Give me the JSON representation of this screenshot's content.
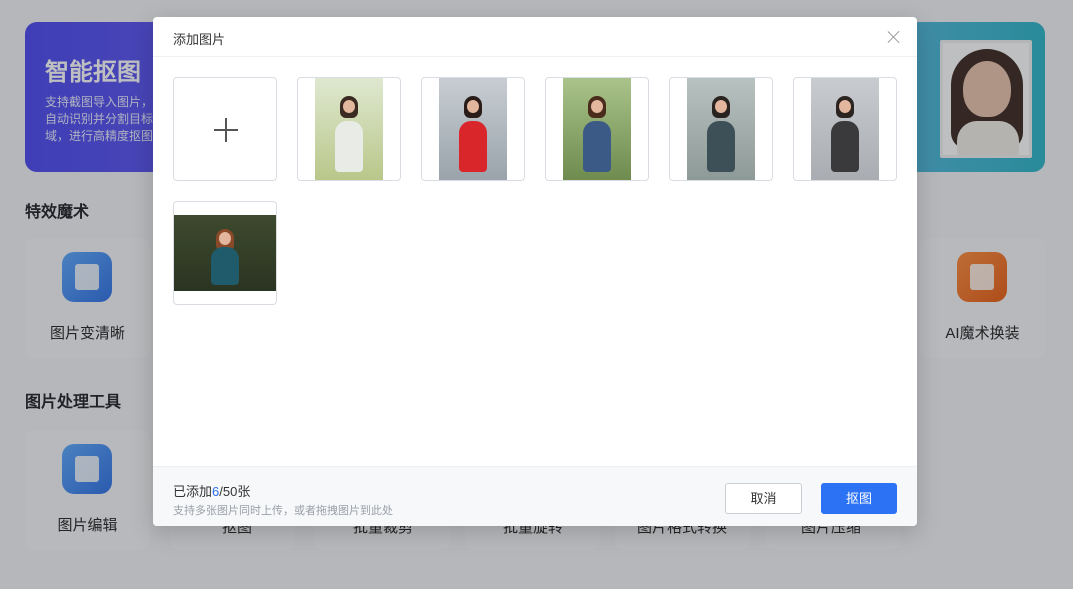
{
  "background": {
    "banner": {
      "title": "智能抠图",
      "desc_line1": "支持截图导入图片，",
      "desc_line2": "自动识别并分割目标",
      "desc_line3": "域，进行高精度抠图"
    },
    "section_effects": "特效魔术",
    "section_tools": "图片处理工具",
    "tools": {
      "sharpen": "图片变清晰",
      "ai_outfit": "AI魔术换装",
      "edit": "图片编辑",
      "crop_partial": "抠图",
      "batch_crop_partial": "批量裁剪",
      "batch_rotate_partial": "批量旋转",
      "format_partial": "图片格式转换",
      "compress_partial": "图片压缩"
    }
  },
  "modal": {
    "title": "添加图片",
    "photos": [
      {
        "name": "photo-1",
        "colors": {
          "bg": "#b9c78a",
          "top": "#dfe8d0",
          "dress": "#e9ebe6",
          "hair": "#3b2a22"
        }
      },
      {
        "name": "photo-2",
        "colors": {
          "bg": "#9aa3ab",
          "top": "#c7cdd2",
          "dress": "#d8262a",
          "hair": "#2a1d19"
        }
      },
      {
        "name": "photo-3",
        "colors": {
          "bg": "#6f8b4e",
          "top": "#a9c38a",
          "dress": "#3b5a86",
          "hair": "#4a2c1c"
        }
      },
      {
        "name": "photo-4",
        "colors": {
          "bg": "#8e9a98",
          "top": "#b8c2c0",
          "dress": "#3d5058",
          "hair": "#2a2420"
        }
      },
      {
        "name": "photo-5",
        "colors": {
          "bg": "#a9adb2",
          "top": "#c8ccd0",
          "dress": "#3a3a3c",
          "hair": "#2b2420"
        }
      },
      {
        "name": "photo-6",
        "colors": {
          "bg": "#2a3422",
          "top": "#3e4a2e",
          "dress": "#1f5b6a",
          "hair": "#8a4a2a"
        }
      }
    ],
    "footer": {
      "count_prefix": "已添加",
      "count_current": "6",
      "count_suffix": "/50张",
      "hint": "支持多张图片同时上传，或者拖拽图片到此处",
      "cancel_label": "取消",
      "confirm_label": "抠图"
    }
  }
}
